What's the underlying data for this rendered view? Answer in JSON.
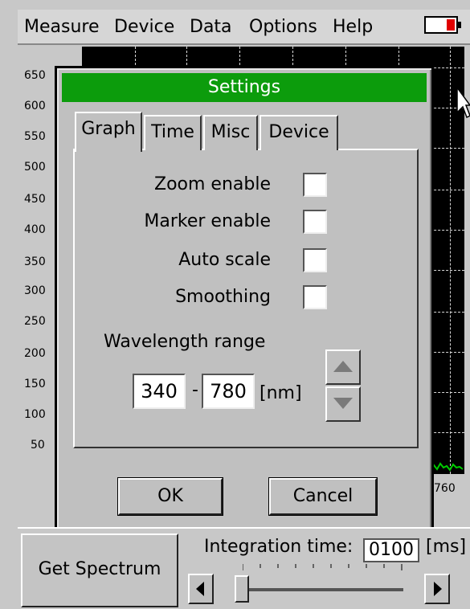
{
  "menubar": {
    "items": [
      "Measure",
      "Device",
      "Data",
      "Options",
      "Help"
    ],
    "battery_icon": "battery-low-icon",
    "battery_color": "#e00000"
  },
  "graph": {
    "y_ticks": [
      "650",
      "600",
      "550",
      "500",
      "450",
      "400",
      "350",
      "300",
      "250",
      "200",
      "150",
      "100",
      "50"
    ],
    "x_tick_visible": "760",
    "signal_color": "#00cc00"
  },
  "dialog": {
    "title": "Settings",
    "title_color": "#0c9c0c",
    "tabs": [
      "Graph",
      "Time",
      "Misc",
      "Device"
    ],
    "active_tab": "Graph",
    "options": [
      {
        "label": "Zoom enable",
        "checked": false
      },
      {
        "label": "Marker enable",
        "checked": false
      },
      {
        "label": "Auto scale",
        "checked": false
      },
      {
        "label": "Smoothing",
        "checked": false
      }
    ],
    "wavelength": {
      "label": "Wavelength range",
      "min": "340",
      "separator": "-",
      "max": "780",
      "unit": "[nm]",
      "up_icon": "arrow-up-icon",
      "down_icon": "arrow-down-icon"
    },
    "ok_label": "OK",
    "cancel_label": "Cancel"
  },
  "bottom": {
    "get_spectrum_label": "Get Spectrum",
    "integration_label": "Integration time:",
    "integration_value": "0100",
    "integration_unit": "[ms]",
    "slider_level": 0
  }
}
